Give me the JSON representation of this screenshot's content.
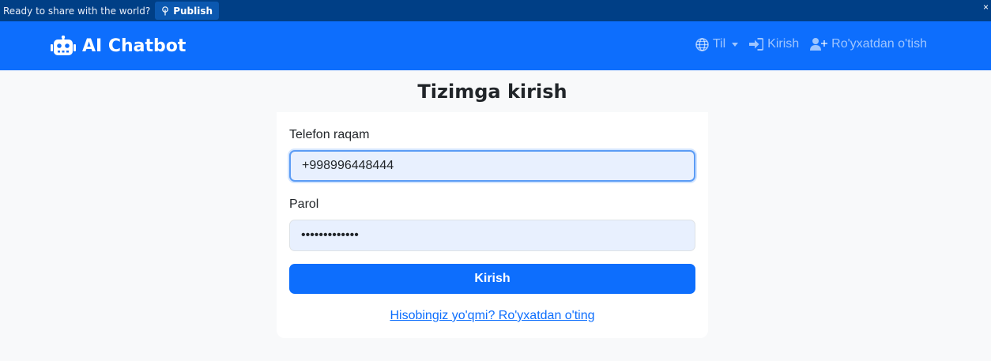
{
  "publish_bar": {
    "prompt": "Ready to share with the world?",
    "publish_label": "Publish",
    "close_label": "×"
  },
  "navbar": {
    "brand": "AI Chatbot",
    "links": {
      "language": "Til",
      "login": "Kirish",
      "register": "Ro'yxatdan o'tish"
    }
  },
  "login_form": {
    "title": "Tizimga kirish",
    "phone_label": "Telefon raqam",
    "phone_value": "+998996448444",
    "password_label": "Parol",
    "password_value": "•••••••••••••",
    "submit_label": "Kirish",
    "register_prompt": "Hisobingiz yo'qmi? Ro'yxatdan o'ting"
  },
  "colors": {
    "primary": "#0d6efd",
    "publish_bar_bg": "#003f86",
    "page_bg": "#f8f9fa",
    "input_bg": "#e8f0fe"
  }
}
